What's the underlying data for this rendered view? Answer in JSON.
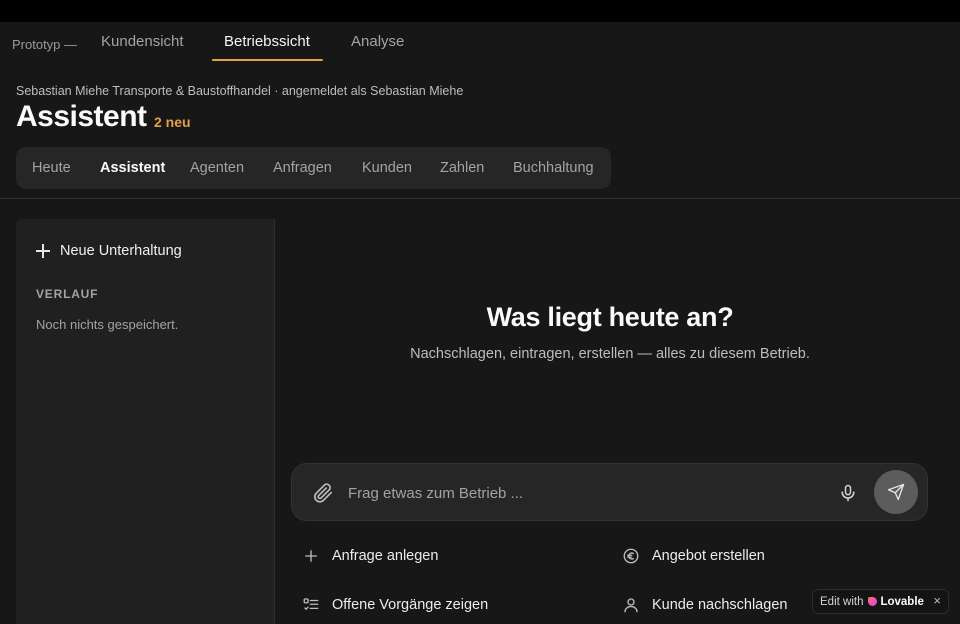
{
  "topnav": {
    "prefix": "Prototyp —",
    "tabs": [
      {
        "label": "Kundensicht"
      },
      {
        "label": "Betriebssicht",
        "active": true
      },
      {
        "label": "Analyse"
      }
    ]
  },
  "header": {
    "company": "Sebastian Miehe Transporte & Baustoffhandel · angemeldet als Sebastian Miehe",
    "title": "Assistent",
    "badge": "2 neu"
  },
  "subnav": {
    "tabs": [
      {
        "label": "Heute"
      },
      {
        "label": "Assistent",
        "active": true
      },
      {
        "label": "Agenten"
      },
      {
        "label": "Anfragen"
      },
      {
        "label": "Kunden"
      },
      {
        "label": "Zahlen"
      },
      {
        "label": "Buchhaltung"
      }
    ]
  },
  "sidebar": {
    "new_chat": "Neue Unterhaltung",
    "history_label": "VERLAUF",
    "history_empty": "Noch nichts gespeichert."
  },
  "main": {
    "headline": "Was liegt heute an?",
    "subline": "Nachschlagen, eintragen, erstellen — alles zu diesem Betrieb.",
    "input_placeholder": "Frag etwas zum Betrieb ...",
    "actions": [
      {
        "label": "Anfrage anlegen",
        "icon": "plus-icon"
      },
      {
        "label": "Angebot erstellen",
        "icon": "euro-icon"
      },
      {
        "label": "Offene Vorgänge zeigen",
        "icon": "list-check-icon"
      },
      {
        "label": "Kunde nachschlagen",
        "icon": "user-icon"
      }
    ]
  },
  "badge": {
    "prefix": "Edit with",
    "brand": "Lovable",
    "close": "×"
  },
  "colors": {
    "background": "#171717",
    "accent": "#e0a24b",
    "panel": "#202020"
  }
}
